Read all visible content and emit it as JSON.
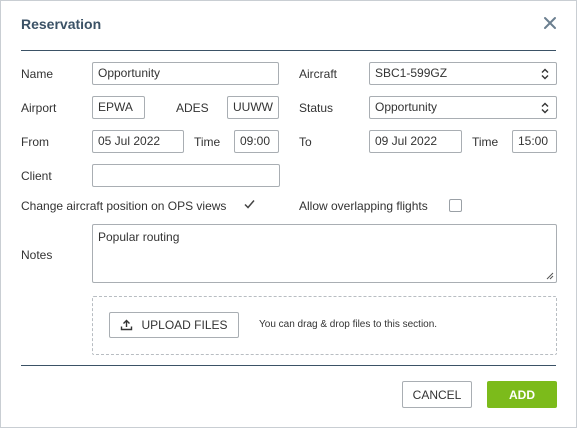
{
  "dialog": {
    "title": "Reservation",
    "close_icon": "close-icon"
  },
  "form": {
    "name": {
      "label": "Name",
      "value": "Opportunity"
    },
    "aircraft": {
      "label": "Aircraft",
      "value": "SBC1-599GZ"
    },
    "airport": {
      "label": "Airport",
      "value": "EPWA"
    },
    "ades": {
      "label": "ADES",
      "value": "UUWW"
    },
    "status": {
      "label": "Status",
      "value": "Opportunity"
    },
    "from": {
      "label": "From",
      "date": "05 Jul 2022",
      "time_label": "Time",
      "time": "09:00"
    },
    "to": {
      "label": "To",
      "date": "09 Jul 2022",
      "time_label": "Time",
      "time": "15:00"
    },
    "client": {
      "label": "Client",
      "value": ""
    },
    "change_position": {
      "label": "Change aircraft position on OPS views",
      "checked": true
    },
    "allow_overlapping": {
      "label": "Allow overlapping flights",
      "checked": false
    },
    "notes": {
      "label": "Notes",
      "value": "Popular routing"
    }
  },
  "upload": {
    "button_label": "UPLOAD FILES",
    "hint": "You can drag & drop files to this section.",
    "icon": "upload-icon"
  },
  "footer": {
    "cancel_label": "CANCEL",
    "add_label": "ADD"
  },
  "colors": {
    "title": "#3b5266",
    "divider": "#3b5266",
    "add_button": "#7cbb1b",
    "border": "#a9aeb3"
  }
}
